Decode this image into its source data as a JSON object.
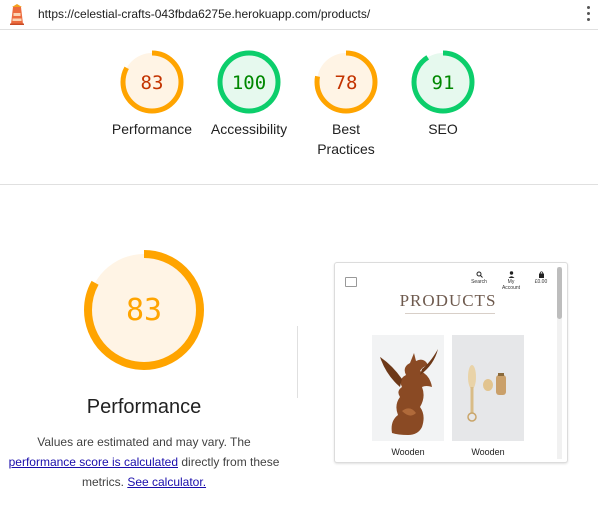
{
  "address_bar": {
    "url": "https://celestial-crafts-043fbda6275e.herokuapp.com/products/"
  },
  "summary": [
    {
      "score": "83",
      "label": "Performance",
      "status": "average"
    },
    {
      "score": "100",
      "label": "Accessibility",
      "status": "pass"
    },
    {
      "score": "78",
      "label": "Best Practices",
      "status": "average"
    },
    {
      "score": "91",
      "label": "SEO",
      "status": "pass"
    }
  ],
  "performance": {
    "score": "83",
    "title": "Performance",
    "note_prefix": "Values are estimated and may vary. The",
    "note_link": "performance score is calculated",
    "note_middle": "directly from these metrics.",
    "note_link2": "See calculator."
  },
  "screenshot": {
    "nav": [
      "Search",
      "My Account",
      "£0.00"
    ],
    "heading": "PRODUCTS",
    "cards": [
      "Wooden",
      "Wooden"
    ]
  },
  "colors": {
    "average": "#ffa400",
    "average_fill": "#fff4e5",
    "average_text": "#c33300",
    "pass": "#0cce6b",
    "pass_fill": "#e6f9ee",
    "pass_text": "#008800"
  }
}
